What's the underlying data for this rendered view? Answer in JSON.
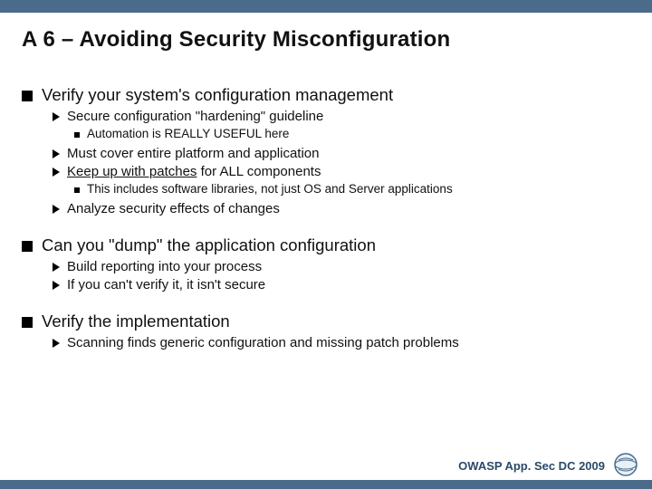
{
  "slide": {
    "title": "A 6 – Avoiding Security Misconfiguration",
    "sections": [
      {
        "text": "Verify your system's configuration management",
        "children": [
          {
            "text": "Secure configuration \"hardening\" guideline",
            "children": [
              {
                "text": "Automation is REALLY USEFUL here"
              }
            ]
          },
          {
            "text": "Must cover entire platform and application"
          },
          {
            "text_prefix": "",
            "underline": "Keep up with patches",
            "text_suffix": " for ALL components",
            "children": [
              {
                "text": "This includes software libraries, not just OS and Server applications"
              }
            ]
          },
          {
            "text": "Analyze security effects of changes"
          }
        ]
      },
      {
        "text": "Can you \"dump\" the application configuration",
        "children": [
          {
            "text": "Build reporting into your process"
          },
          {
            "text": "If you can't verify it, it isn't secure"
          }
        ]
      },
      {
        "text": "Verify the implementation",
        "children": [
          {
            "text": "Scanning finds generic configuration and missing patch problems"
          }
        ]
      }
    ],
    "footer": "OWASP App. Sec DC 2009"
  }
}
